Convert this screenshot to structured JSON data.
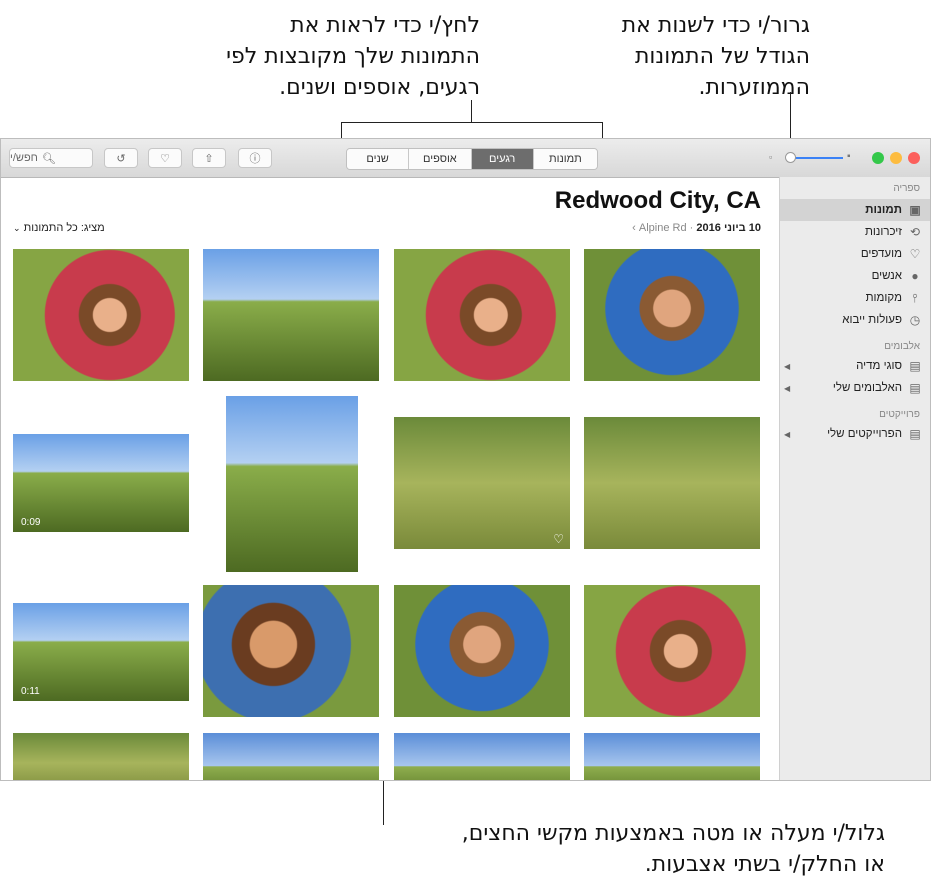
{
  "callouts": {
    "view_buttons": [
      "לחץ/י כדי לראות את",
      "התמונות שלך מקובצות לפי",
      "רגעים, אוספים ושנים."
    ],
    "slider": [
      "גרור/י כדי לשנות את",
      "הגודל של התמונות",
      "הממוזערות."
    ],
    "scroll": [
      "גלול/י מעלה או מטה באמצעות מקשי החצים,",
      "או החלק/י בשתי אצבעות."
    ]
  },
  "toolbar": {
    "search_placeholder": "חפש/י",
    "view_segments": [
      {
        "label": "שנים",
        "active": false
      },
      {
        "label": "אוספים",
        "active": false
      },
      {
        "label": "רגעים",
        "active": true
      },
      {
        "label": "תמונות",
        "active": false
      }
    ],
    "traffic_lights": {
      "close": "#fc605c",
      "minimize": "#fdbc40",
      "zoom": "#34c84a"
    },
    "slider_accent": "#3b82f6"
  },
  "sidebar": {
    "library_header": "ספריה",
    "library_items": [
      {
        "label": "תמונות",
        "icon": "photos-icon",
        "selected": true
      },
      {
        "label": "זיכרונות",
        "icon": "memories-icon",
        "selected": false
      },
      {
        "label": "מועדפים",
        "icon": "heart-icon",
        "selected": false
      },
      {
        "label": "אנשים",
        "icon": "person-icon",
        "selected": false
      },
      {
        "label": "מקומות",
        "icon": "pin-icon",
        "selected": false
      },
      {
        "label": "פעולות ייבוא",
        "icon": "clock-icon",
        "selected": false
      }
    ],
    "albums_header": "אלבומים",
    "album_items": [
      {
        "label": "סוגי מדיה",
        "icon": "folder-icon"
      },
      {
        "label": "האלבומים שלי",
        "icon": "folder-icon"
      }
    ],
    "projects_header": "פרוייקטים",
    "project_items": [
      {
        "label": "הפרוייקטים שלי",
        "icon": "folder-icon"
      }
    ]
  },
  "main": {
    "title": "Redwood City, CA",
    "date": "10 ביוני 2016",
    "separator": "·",
    "sublocation": "Alpine Rd",
    "filter_label": "מציג: כל התמונות"
  },
  "photos": [
    {
      "style": "pink"
    },
    {
      "style": "hill"
    },
    {
      "style": "pink"
    },
    {
      "style": "blue"
    },
    {
      "style": "hill",
      "badge": "0:09"
    },
    {
      "style": "hill"
    },
    {
      "style": "grass",
      "favorite": true
    },
    {
      "style": "grass"
    },
    {
      "style": "hill",
      "badge": "0:11"
    },
    {
      "style": "close"
    },
    {
      "style": "blue"
    },
    {
      "style": "pink"
    },
    {
      "style": "grass"
    },
    {
      "style": "sky"
    },
    {
      "style": "sky"
    },
    {
      "style": "sky"
    }
  ]
}
